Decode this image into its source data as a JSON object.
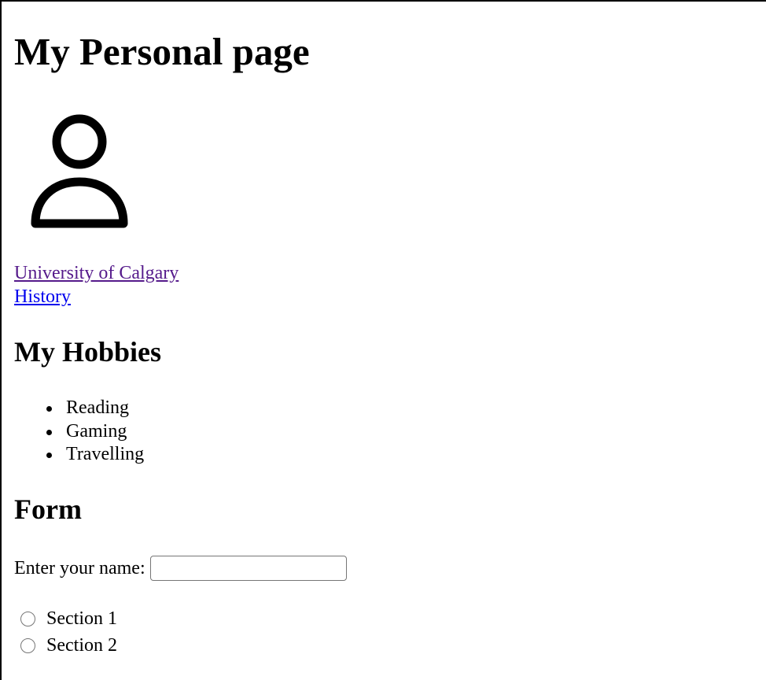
{
  "page": {
    "heading": "My Personal page"
  },
  "avatar": {
    "icon": "user-icon"
  },
  "links": [
    {
      "label": "University of Calgary",
      "state": "visited",
      "color": "#551a8b"
    },
    {
      "label": "History",
      "state": "unvisited",
      "color": "#0000ee"
    }
  ],
  "hobbies": {
    "heading": "My Hobbies",
    "items": [
      "Reading",
      "Gaming",
      "Travelling"
    ]
  },
  "form": {
    "heading": "Form",
    "name_label": "Enter your name:",
    "name_value": "",
    "options": [
      {
        "label": "Section 1",
        "checked": false
      },
      {
        "label": "Section 2",
        "checked": false
      }
    ]
  }
}
